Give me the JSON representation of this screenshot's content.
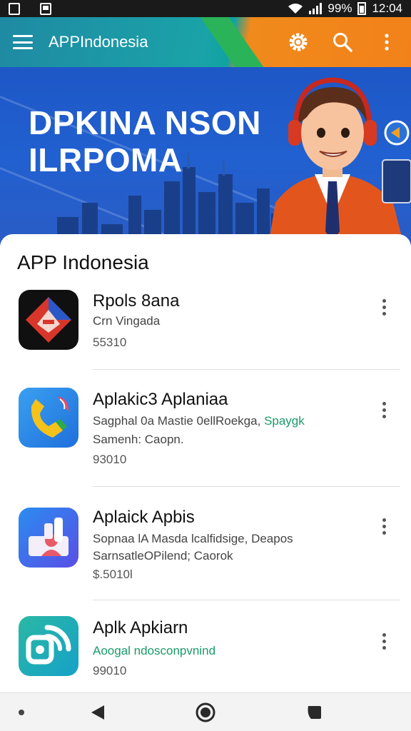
{
  "status_bar": {
    "battery": "99%",
    "time": "12:04"
  },
  "app_bar": {
    "title": "APPIndonesia",
    "menu_icon": "hamburger-icon",
    "actions": [
      "settings-icon",
      "search-icon",
      "more-vert-icon"
    ]
  },
  "banner": {
    "line1": "DPKINA NSON",
    "line2": "ILRPOMA"
  },
  "section": {
    "title": "APP Indonesia"
  },
  "apps": [
    {
      "name": "Rpols 8ana",
      "subtitle": "Crn Vingada",
      "price": "55310",
      "icon": "red-diamond-app-icon"
    },
    {
      "name": "Aplakic3 Aplaniaa",
      "subtitle": "Sagphal 0a Mastie 0ellRoekga,",
      "subtitle_accent": "Spaygk",
      "subtitle2": "Samenh: Caopn.",
      "price": "93010",
      "icon": "phone-app-icon"
    },
    {
      "name": "Aplaick Apbis",
      "subtitle": "Sopnaa lA Masda lcalfidsige, Deapos",
      "subtitle2": "SarnsatleOPilend; Caorok",
      "price": "$.5010l",
      "icon": "contact-app-icon"
    },
    {
      "name": "Aplk Apkiarn",
      "subtitle": "Aoogal ndosconpvnind",
      "price": "99010",
      "icon": "teal-broadcast-app-icon"
    }
  ],
  "colors": {
    "app_bar_teal": "#1aa3a8",
    "app_bar_orange": "#f2811a",
    "banner_blue": "#2160d0",
    "accent_green": "#1a9a6a"
  }
}
